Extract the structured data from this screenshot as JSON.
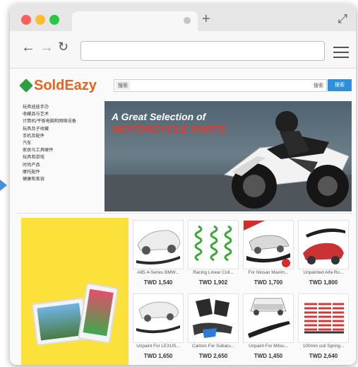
{
  "header": {
    "logo_text": "SoldEazy",
    "search_category": "搜索",
    "search_label": "搜索",
    "search_placeholder": "",
    "search_button": "搜索"
  },
  "categories": [
    "玩具娃娃手办",
    "收藏品与艺术",
    "计算机/平板电脑和网络设备",
    "玩具及子收藏",
    "手机及配件",
    "汽车",
    "家居与工具硬件",
    "玩具和游戏",
    "时尚产品",
    "摩托配件",
    "健康和美容"
  ],
  "banner": {
    "line1": "A Great Selection of",
    "line2": "MOTORCYCLE PARTS"
  },
  "products": [
    {
      "name": "A85 4-Series BMW...",
      "price": "TWD 1,540"
    },
    {
      "name": "Racing Linear Coil...",
      "price": "TWD 1,902"
    },
    {
      "name": "For Nissan Maxim...",
      "price": "TWD 1,700"
    },
    {
      "name": "Unpainted Alfa Ro...",
      "price": "TWD 1,800"
    },
    {
      "name": "Unpaint For LEXUS...",
      "price": "TWD 1,650"
    },
    {
      "name": "Carbon For Subaru...",
      "price": "TWD 2,650"
    },
    {
      "name": "Unpaint For Mitsu...",
      "price": "TWD 1,450"
    },
    {
      "name": "100mm coil Spring...",
      "price": "TWD 2,640"
    }
  ],
  "colors": {
    "accent": "#2f8fd8",
    "promo": "#fbe13a",
    "logo_orange": "#e8631c",
    "logo_blue": "#1f5ea8",
    "close": "#ff5f57",
    "minimize": "#febc2e",
    "maximize": "#28c840"
  },
  "icons": [
    "back-arrow-icon",
    "forward-arrow-icon",
    "reload-icon",
    "menu-icon",
    "expand-icon",
    "new-tab-icon"
  ]
}
